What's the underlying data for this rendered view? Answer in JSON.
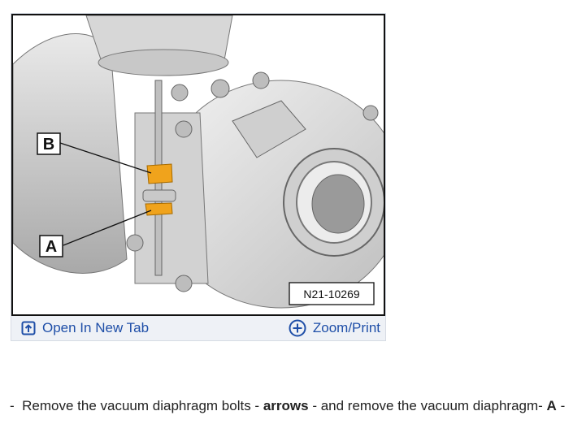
{
  "figure": {
    "callouts": [
      {
        "letter": "B"
      },
      {
        "letter": "A"
      }
    ],
    "figure_id": "N21-10269",
    "open_tab_label": "Open In New Tab",
    "zoom_label": "Zoom/Print"
  },
  "instruction": {
    "bullet": "-",
    "part1": "Remove the vacuum diaphragm bolts -",
    "arrows": "arrows",
    "part2": "- and remove the vacuum diaphragm-",
    "ref": "A",
    "trail": "-"
  },
  "colors": {
    "link": "#1f4fa8",
    "toolbar_bg": "#eef1f6",
    "highlight": "#f0a31c",
    "metal": "#d9d9d9"
  }
}
